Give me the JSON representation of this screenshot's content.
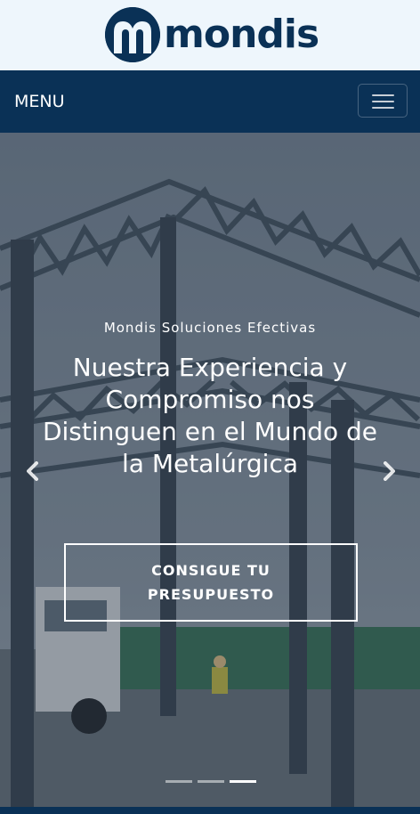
{
  "brand": {
    "logo_text": "mondis",
    "colors": {
      "primary": "#0a3156",
      "header_bg": "#eef6fc",
      "text_light": "#ffffff"
    }
  },
  "navbar": {
    "menu_label": "MENU",
    "toggler_icon": "hamburger-icon"
  },
  "hero": {
    "subtitle": "Mondis Soluciones Efectivas",
    "title": "Nuestra Experiencia y Compromiso nos Distinguen en el Mundo de la Metalúrgica",
    "cta_label": "CONSIGUE TU PRESUPUESTO",
    "prev_icon": "chevron-left-icon",
    "next_icon": "chevron-right-icon",
    "slides_total": 3,
    "active_slide": 3
  }
}
